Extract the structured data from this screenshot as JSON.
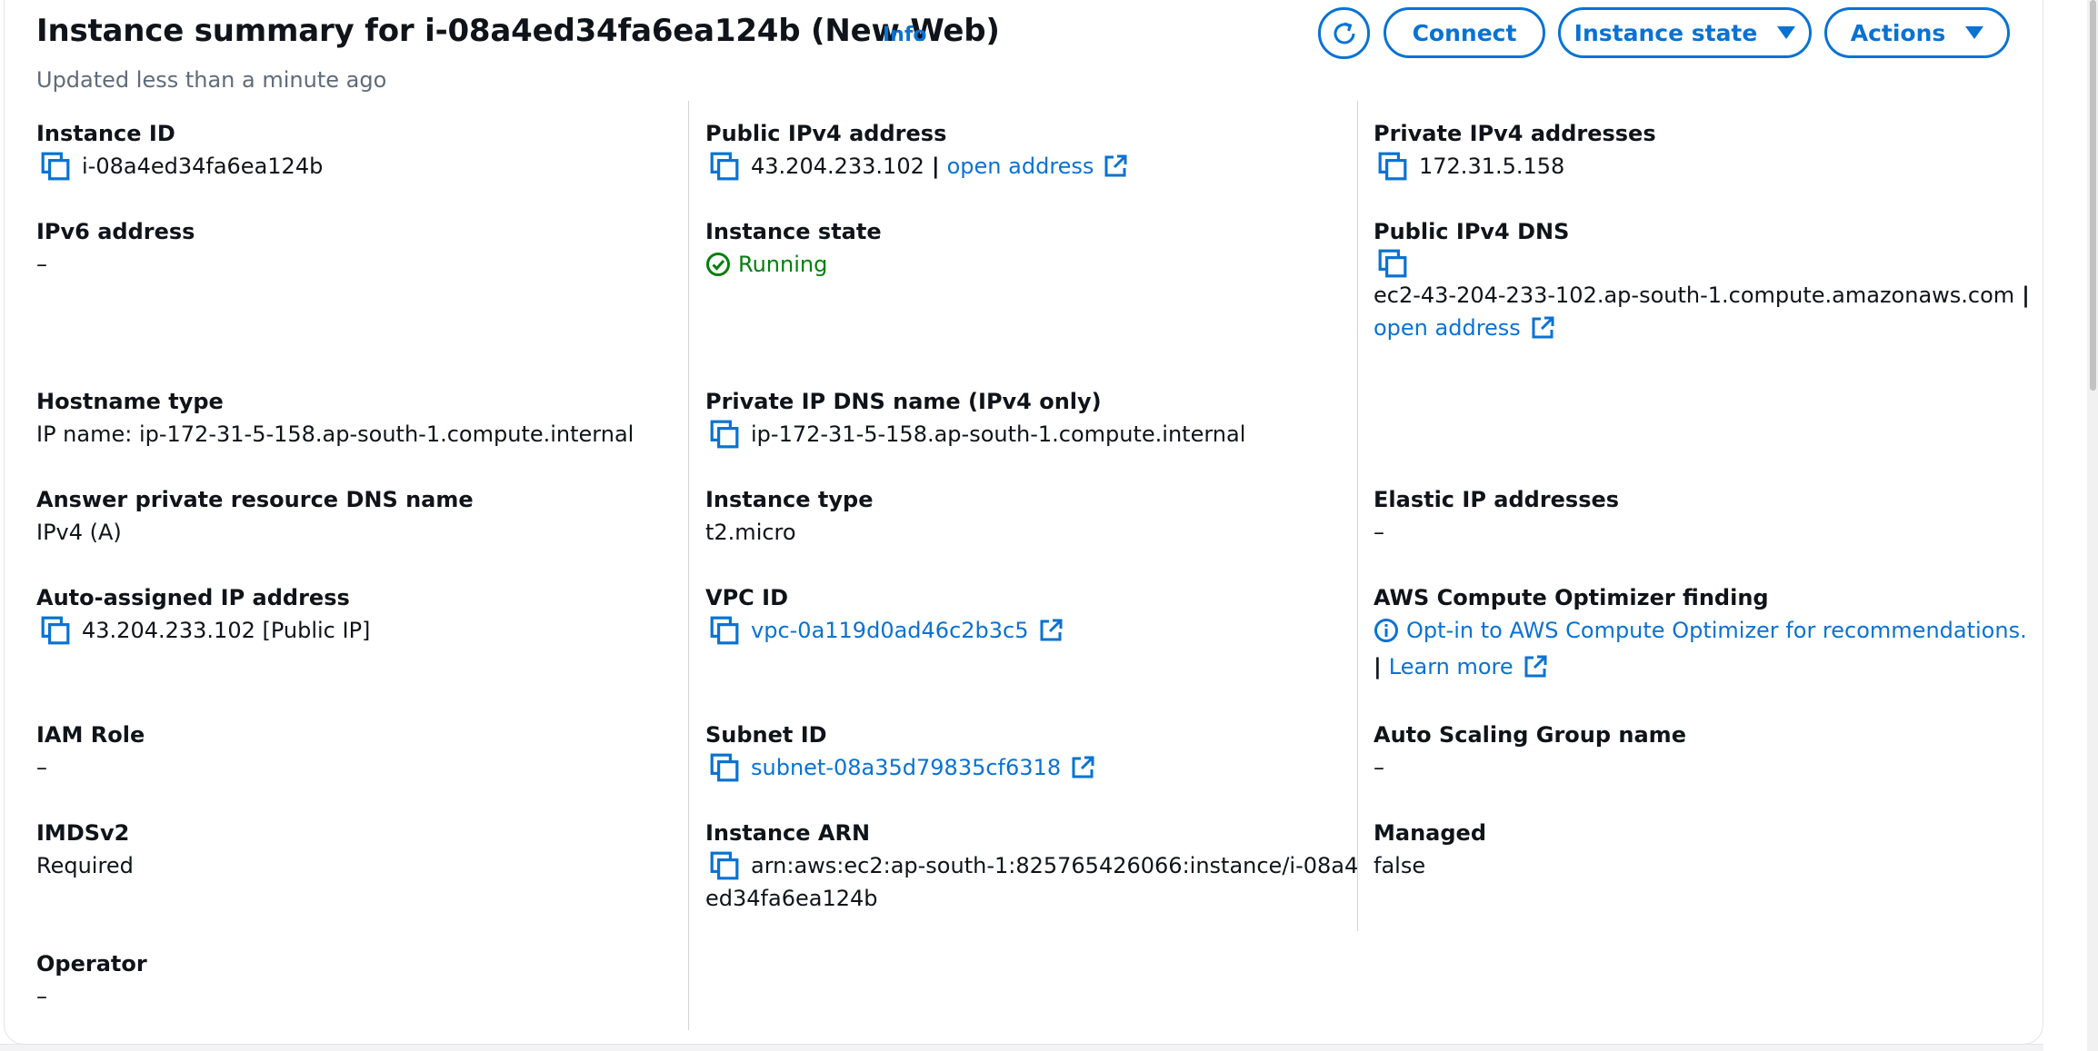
{
  "header": {
    "title": "Instance summary for i-08a4ed34fa6ea124b (New Web)",
    "info_label": "Info",
    "updated": "Updated less than a minute ago"
  },
  "buttons": {
    "connect": "Connect",
    "instance_state": "Instance state",
    "actions": "Actions"
  },
  "fields": {
    "instance_id": {
      "label": "Instance ID",
      "value": "i-08a4ed34fa6ea124b"
    },
    "public_ipv4": {
      "label": "Public IPv4 address",
      "value": "43.204.233.102",
      "link": "open address"
    },
    "private_ipv4": {
      "label": "Private IPv4 addresses",
      "value": "172.31.5.158"
    },
    "ipv6": {
      "label": "IPv6 address",
      "value": "–"
    },
    "instance_state": {
      "label": "Instance state",
      "value": "Running"
    },
    "public_dns": {
      "label": "Public IPv4 DNS",
      "value": "ec2-43-204-233-102.ap-south-1.compute.amazonaws.com",
      "link": "open address"
    },
    "hostname_type": {
      "label": "Hostname type",
      "value": "IP name: ip-172-31-5-158.ap-south-1.compute.internal"
    },
    "private_dns": {
      "label": "Private IP DNS name (IPv4 only)",
      "value": "ip-172-31-5-158.ap-south-1.compute.internal"
    },
    "answer_dns": {
      "label": "Answer private resource DNS name",
      "value": "IPv4 (A)"
    },
    "instance_type": {
      "label": "Instance type",
      "value": "t2.micro"
    },
    "elastic_ip": {
      "label": "Elastic IP addresses",
      "value": "–"
    },
    "auto_ip": {
      "label": "Auto-assigned IP address",
      "value": "43.204.233.102 [Public IP]"
    },
    "vpc_id": {
      "label": "VPC ID",
      "value": "vpc-0a119d0ad46c2b3c5"
    },
    "optimizer": {
      "label": "AWS Compute Optimizer finding",
      "value": "Opt-in to AWS Compute Optimizer for recommendations.",
      "link": "Learn more"
    },
    "iam_role": {
      "label": "IAM Role",
      "value": "–"
    },
    "subnet_id": {
      "label": "Subnet ID",
      "value": "subnet-08a35d79835cf6318"
    },
    "asg_name": {
      "label": "Auto Scaling Group name",
      "value": "–"
    },
    "imdsv2": {
      "label": "IMDSv2",
      "value": "Required"
    },
    "instance_arn": {
      "label": "Instance ARN",
      "value_line1": "arn:aws:ec2:ap-south-1:825765426066:instance/i-08a4",
      "value_line2": "ed34fa6ea124b"
    },
    "managed": {
      "label": "Managed",
      "value": "false"
    },
    "operator": {
      "label": "Operator",
      "value": "–"
    }
  },
  "colors": {
    "link": "#0972d3",
    "success": "#037f0c",
    "text": "#0f141a",
    "muted": "#5f6b7a"
  }
}
